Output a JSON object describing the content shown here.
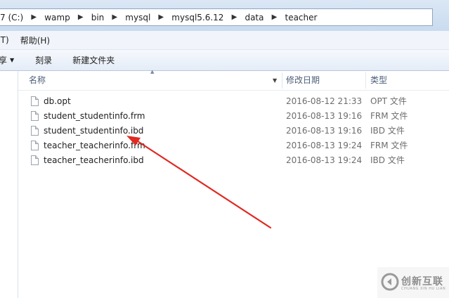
{
  "address": {
    "crumbs": [
      {
        "label": "7 (C:)"
      },
      {
        "label": "wamp"
      },
      {
        "label": "bin"
      },
      {
        "label": "mysql"
      },
      {
        "label": "mysql5.6.12"
      },
      {
        "label": "data"
      },
      {
        "label": "teacher"
      }
    ],
    "separator": "▶"
  },
  "menu": {
    "items": [
      "(T)",
      "帮助(H)"
    ]
  },
  "toolbar": {
    "share_label": "享",
    "burn_label": "刻录",
    "new_folder_label": "新建文件夹"
  },
  "columns": {
    "name": "名称",
    "date": "修改日期",
    "type": "类型"
  },
  "files": [
    {
      "name": "db.opt",
      "date": "2016-08-12  21:33",
      "type": "OPT 文件"
    },
    {
      "name": "student_studentinfo.frm",
      "date": "2016-08-13  19:16",
      "type": "FRM 文件"
    },
    {
      "name": "student_studentinfo.ibd",
      "date": "2016-08-13  19:16",
      "type": "IBD 文件"
    },
    {
      "name": "teacher_teacherinfo.frm",
      "date": "2016-08-13  19:24",
      "type": "FRM 文件"
    },
    {
      "name": "teacher_teacherinfo.ibd",
      "date": "2016-08-13  19:24",
      "type": "IBD 文件"
    }
  ],
  "annotation": {
    "color": "#e02a22"
  },
  "watermark": {
    "text": "创新互联",
    "sub": "CHUANG XIN HU LIAN"
  }
}
